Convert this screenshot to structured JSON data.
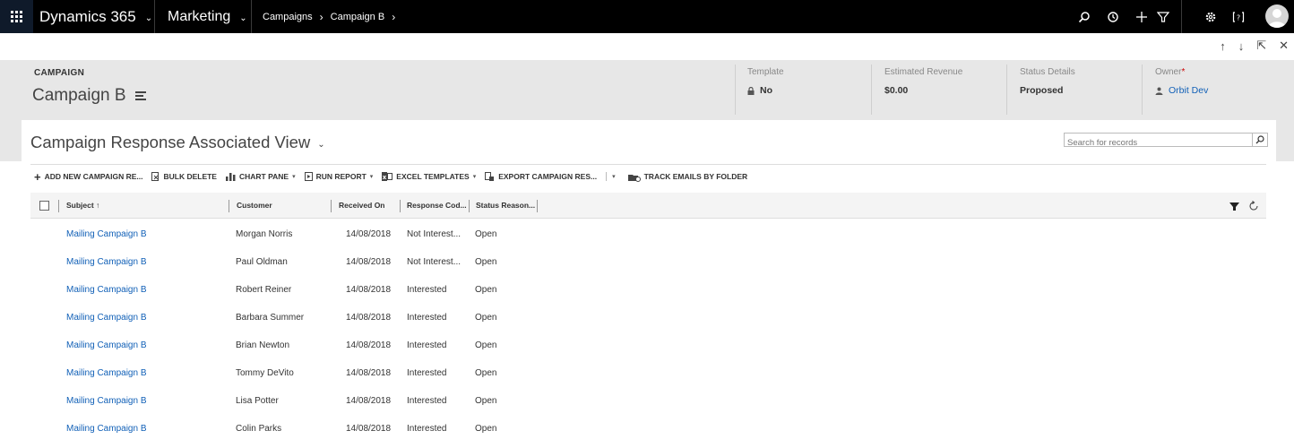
{
  "nav": {
    "app_name": "Dynamics 365",
    "module": "Marketing",
    "breadcrumb": [
      "Campaigns",
      "Campaign B"
    ]
  },
  "header": {
    "entity": "CAMPAIGN",
    "record_name": "Campaign B",
    "fields": [
      {
        "label": "Template",
        "value": "No"
      },
      {
        "label": "Estimated Revenue",
        "value": "$0.00"
      },
      {
        "label": "Status Details",
        "value": "Proposed"
      },
      {
        "label": "Owner",
        "value": "Orbit Dev"
      }
    ]
  },
  "view": {
    "title": "Campaign Response Associated View",
    "search_placeholder": "Search for records"
  },
  "commands": [
    "ADD NEW CAMPAIGN RE...",
    "BULK DELETE",
    "CHART PANE",
    "RUN REPORT",
    "EXCEL TEMPLATES",
    "EXPORT CAMPAIGN RES...",
    "TRACK EMAILS BY FOLDER"
  ],
  "grid": {
    "columns": [
      "Subject ↑",
      "Customer",
      "Received On",
      "Response Cod...",
      "Status Reason..."
    ],
    "rows": [
      {
        "subject": "Mailing Campaign B",
        "customer": "Morgan Norris",
        "received": "14/08/2018",
        "response": "Not Interest...",
        "status": "Open"
      },
      {
        "subject": "Mailing Campaign B",
        "customer": "Paul Oldman",
        "received": "14/08/2018",
        "response": "Not Interest...",
        "status": "Open"
      },
      {
        "subject": "Mailing Campaign B",
        "customer": "Robert Reiner",
        "received": "14/08/2018",
        "response": "Interested",
        "status": "Open"
      },
      {
        "subject": "Mailing Campaign B",
        "customer": "Barbara Summer",
        "received": "14/08/2018",
        "response": "Interested",
        "status": "Open"
      },
      {
        "subject": "Mailing Campaign B",
        "customer": "Brian Newton",
        "received": "14/08/2018",
        "response": "Interested",
        "status": "Open"
      },
      {
        "subject": "Mailing Campaign B",
        "customer": "Tommy DeVito",
        "received": "14/08/2018",
        "response": "Interested",
        "status": "Open"
      },
      {
        "subject": "Mailing Campaign B",
        "customer": "Lisa Potter",
        "received": "14/08/2018",
        "response": "Interested",
        "status": "Open"
      },
      {
        "subject": "Mailing Campaign B",
        "customer": "Colin Parks",
        "received": "14/08/2018",
        "response": "Interested",
        "status": "Open"
      }
    ]
  },
  "icons": {
    "top_nav": [
      "search-icon",
      "history-icon",
      "plus-icon",
      "filter-icon",
      "gear-icon",
      "help-icon",
      "avatar"
    ],
    "record_nav": [
      "arrow-up-icon",
      "arrow-down-icon",
      "expand-icon",
      "close-icon"
    ]
  },
  "colors": {
    "link": "#1160b7",
    "topbar": "#000000",
    "header_band": "#e7e7e7"
  }
}
